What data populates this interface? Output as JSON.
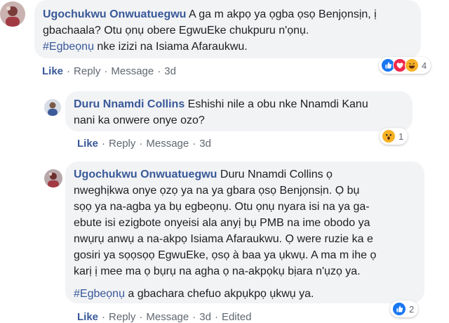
{
  "comments": [
    {
      "author": "Ugochukwu Onwuatuegwu",
      "text_lines": [
        "A ga m akpọ ya ọgba ọsọ Benjọnsịn, ị",
        "gbachaala? Otu ọnụ obere EgwuEke chukpuru n'ọnụ."
      ],
      "hashtag": "#Egbeọnụ",
      "hashtag_rest": " nke izizi na Isiama Afaraukwu.",
      "actions": {
        "like": "Like",
        "reply": "Reply",
        "message": "Message",
        "time": "3d"
      },
      "reaction_count": "4"
    },
    {
      "author": "Duru Nnamdi Collins",
      "text_first": " Eshishi nile a obu nke Nnamdi Kanu",
      "text_lines": [
        "nani ka onwere onye ozo?"
      ],
      "actions": {
        "like": "Like",
        "reply": "Reply",
        "message": "Message",
        "time": "3d"
      },
      "reaction_count": "1"
    },
    {
      "author": "Ugochukwu Onwuatuegwu",
      "text_first": " Duru Nnamdi Collins ọ",
      "text_lines": [
        "nweghịkwa onye ọzọ ya na ya gbara ọsọ Benjọnsịn. Ọ bụ",
        "sọọ ya na-agba ya bụ egbeọnụ. Otu ọnụ nyara isi na ya ga-",
        "ebute isi ezigbote onyeisi ala anyị bụ PMB na ime obodo ya",
        "nwụrụ anwụ a na-akpọ Isiama Afaraukwu. Ọ were ruzie ka e",
        "gosiri ya sọọsọọ EgwuEke, ọsọ à baa ya ụkwụ. A ma m ihe ọ",
        "karị ị mee ma ọ bụrụ na agha ọ na-akpọkụ bịara n'ụzọ ya."
      ],
      "hashtag": "#Egbeọnụ",
      "hashtag_rest": " a gbachara chefuo akpụkpọ ụkwụ ya.",
      "actions": {
        "like": "Like",
        "reply": "Reply",
        "message": "Message",
        "time": "3d",
        "edited": "Edited"
      },
      "reaction_count": "2"
    }
  ],
  "reaction_icons": [
    "like-icon",
    "love-icon",
    "haha-icon",
    "wow-icon"
  ],
  "colors": {
    "link": "#385898",
    "bubble": "#f2f3f5",
    "meta": "#606770",
    "like_blue": "#1877f2",
    "love_red": "#f0284a",
    "emoji_yellow": "#f7b125"
  }
}
